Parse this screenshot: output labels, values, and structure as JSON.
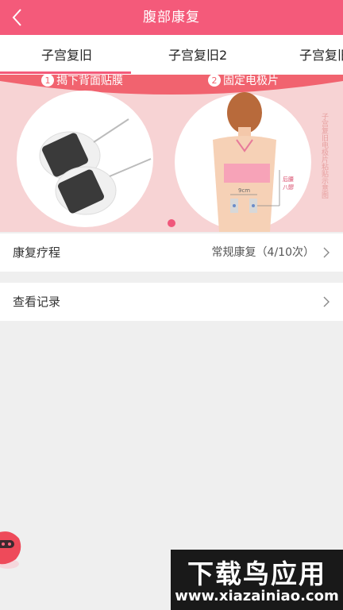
{
  "header": {
    "title": "腹部康复",
    "back_icon": "chevron-left-icon",
    "background": "#f45a7a"
  },
  "tabs": [
    {
      "label": "子宫复旧",
      "active": true
    },
    {
      "label": "子宫复旧2",
      "active": false
    },
    {
      "label": "子宫复旧",
      "active": false
    }
  ],
  "banner": {
    "step1": "揭下背面贴膜",
    "step1_num": "1",
    "step2": "固定电极片",
    "step2_num": "2",
    "side_caption": "子宫复旧电极片粘贴示意图",
    "figure_label_line1": "后腰",
    "figure_label_line2": "八髎",
    "figure_measure": "9cm",
    "page_count": 1,
    "active_page": 1
  },
  "rows": [
    {
      "label": "康复疗程",
      "value": "常规康复（4/10次）",
      "icon": "chevron-right-icon"
    },
    {
      "label": "查看记录",
      "value": "",
      "icon": "chevron-right-icon"
    }
  ],
  "watermark": {
    "main": "下载鸟应用",
    "sub": "www.xiazainiao.com"
  },
  "colors": {
    "accent": "#f45a7a",
    "page_background": "#efefef",
    "banner_background": "#f7d3d4"
  }
}
